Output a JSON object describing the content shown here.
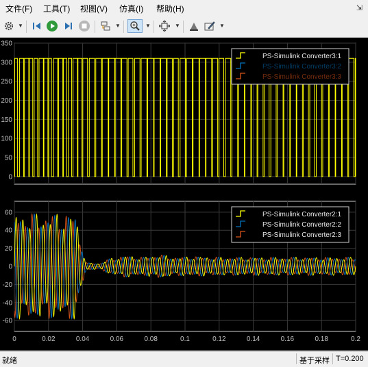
{
  "menu": [
    "文件(F)",
    "工具(T)",
    "视图(V)",
    "仿真(I)",
    "帮助(H)"
  ],
  "toolbar": {
    "icons": [
      "gear-icon",
      "step-back-icon",
      "run-icon",
      "step-forward-icon",
      "stop-icon",
      "layout-icon",
      "zoom-in-icon",
      "fit-view-icon",
      "highlight-icon",
      "edit-icon"
    ]
  },
  "status": {
    "text": "就绪",
    "mode": "基于采样",
    "time": "T=0.200"
  },
  "colors": {
    "yellow": "#ffff00",
    "blue": "#0072bd",
    "orange": "#d95319",
    "grid": "#3a3a3a",
    "axis": "#c0c0c0"
  },
  "chart_data": [
    {
      "type": "line",
      "yticks": [
        0,
        50,
        100,
        150,
        200,
        250,
        300,
        350
      ],
      "ylim": [
        -20,
        350
      ],
      "xlim": [
        0,
        0.2
      ],
      "grid": true,
      "legend_position": "top-right",
      "series": [
        {
          "name": "PS-Simulink Converter3:1",
          "color": "#ffff00",
          "pulse_high": 310,
          "pulse_low": 0,
          "pulse_period_early": 0.00285,
          "pulse_period_late": 0.0038,
          "transition_x": 0.038
        },
        {
          "name": "PS-Simulink Converter3:2",
          "color": "#0072bd"
        },
        {
          "name": "PS-Simulink Converter3:3",
          "color": "#d95319"
        }
      ]
    },
    {
      "type": "line",
      "xticks": [
        0,
        0.02,
        0.04,
        0.06,
        0.08,
        0.1,
        0.12,
        0.14,
        0.16,
        0.18,
        0.2
      ],
      "xticklabels": [
        "0",
        "0.02",
        "0.04",
        "0.06",
        "0.08",
        "0.1",
        "0.12",
        "0.14",
        "0.16",
        "0.18",
        "0.2"
      ],
      "yticks": [
        -60,
        -40,
        -20,
        0,
        20,
        40,
        60
      ],
      "ylim": [
        -72,
        72
      ],
      "xlim": [
        0,
        0.2
      ],
      "grid": true,
      "legend_position": "top-right",
      "series": [
        {
          "name": "PS-Simulink Converter2:1",
          "color": "#ffff00"
        },
        {
          "name": "PS-Simulink Converter2:2",
          "color": "#0072bd"
        },
        {
          "name": "PS-Simulink Converter2:3",
          "color": "#d95319"
        }
      ],
      "envelope": [
        {
          "x": 0.0,
          "amp": 58
        },
        {
          "x": 0.036,
          "amp": 58
        },
        {
          "x": 0.038,
          "amp": 35
        },
        {
          "x": 0.042,
          "amp": 4
        },
        {
          "x": 0.05,
          "amp": 3
        },
        {
          "x": 0.055,
          "amp": 8
        },
        {
          "x": 0.065,
          "amp": 12
        },
        {
          "x": 0.075,
          "amp": 10
        },
        {
          "x": 0.085,
          "amp": 13
        },
        {
          "x": 0.095,
          "amp": 10
        },
        {
          "x": 0.105,
          "amp": 11
        },
        {
          "x": 0.12,
          "amp": 10
        },
        {
          "x": 0.14,
          "amp": 10
        },
        {
          "x": 0.16,
          "amp": 10
        },
        {
          "x": 0.18,
          "amp": 10
        },
        {
          "x": 0.2,
          "amp": 10
        }
      ],
      "frequency_hz": 50
    }
  ]
}
